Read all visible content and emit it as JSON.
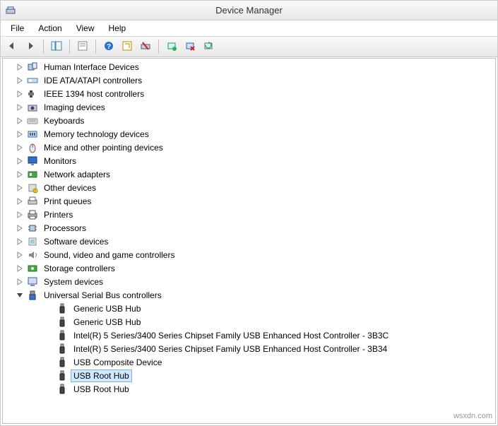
{
  "window": {
    "title": "Device Manager"
  },
  "menubar": {
    "file": "File",
    "action": "Action",
    "view": "View",
    "help": "Help"
  },
  "toolbar": {
    "back": "Back",
    "forward": "Forward",
    "show_hide": "Show/Hide Console Tree",
    "properties": "Properties",
    "help": "Help",
    "refresh": "Refresh",
    "remove": "Remove",
    "scan": "Scan for hardware changes",
    "uninstall": "Uninstall",
    "update": "Update"
  },
  "tree": {
    "categories": [
      {
        "label": "Human Interface Devices",
        "icon": "hid-icon",
        "expanded": false
      },
      {
        "label": "IDE ATA/ATAPI controllers",
        "icon": "ide-icon",
        "expanded": false
      },
      {
        "label": "IEEE 1394 host controllers",
        "icon": "ieee-icon",
        "expanded": false
      },
      {
        "label": "Imaging devices",
        "icon": "imaging-icon",
        "expanded": false
      },
      {
        "label": "Keyboards",
        "icon": "keyboard-icon",
        "expanded": false
      },
      {
        "label": "Memory technology devices",
        "icon": "memory-icon",
        "expanded": false
      },
      {
        "label": "Mice and other pointing devices",
        "icon": "mouse-icon",
        "expanded": false
      },
      {
        "label": "Monitors",
        "icon": "monitor-icon",
        "expanded": false
      },
      {
        "label": "Network adapters",
        "icon": "network-icon",
        "expanded": false
      },
      {
        "label": "Other devices",
        "icon": "other-icon",
        "expanded": false
      },
      {
        "label": "Print queues",
        "icon": "printqueue-icon",
        "expanded": false
      },
      {
        "label": "Printers",
        "icon": "printer-icon",
        "expanded": false
      },
      {
        "label": "Processors",
        "icon": "processor-icon",
        "expanded": false
      },
      {
        "label": "Software devices",
        "icon": "software-icon",
        "expanded": false
      },
      {
        "label": "Sound, video and game controllers",
        "icon": "sound-icon",
        "expanded": false
      },
      {
        "label": "Storage controllers",
        "icon": "storage-icon",
        "expanded": false
      },
      {
        "label": "System devices",
        "icon": "system-icon",
        "expanded": false
      },
      {
        "label": "Universal Serial Bus controllers",
        "icon": "usb-icon",
        "expanded": true,
        "children": [
          {
            "label": "Generic USB Hub",
            "icon": "usb-device-icon",
            "selected": false
          },
          {
            "label": "Generic USB Hub",
            "icon": "usb-device-icon",
            "selected": false
          },
          {
            "label": "Intel(R) 5 Series/3400 Series Chipset Family USB Enhanced Host Controller - 3B3C",
            "icon": "usb-device-icon",
            "selected": false
          },
          {
            "label": "Intel(R) 5 Series/3400 Series Chipset Family USB Enhanced Host Controller - 3B34",
            "icon": "usb-device-icon",
            "selected": false
          },
          {
            "label": "USB Composite Device",
            "icon": "usb-device-icon",
            "selected": false
          },
          {
            "label": "USB Root Hub",
            "icon": "usb-device-icon",
            "selected": true
          },
          {
            "label": "USB Root Hub",
            "icon": "usb-device-icon",
            "selected": false
          }
        ]
      }
    ]
  },
  "watermark": "wsxdn.com"
}
